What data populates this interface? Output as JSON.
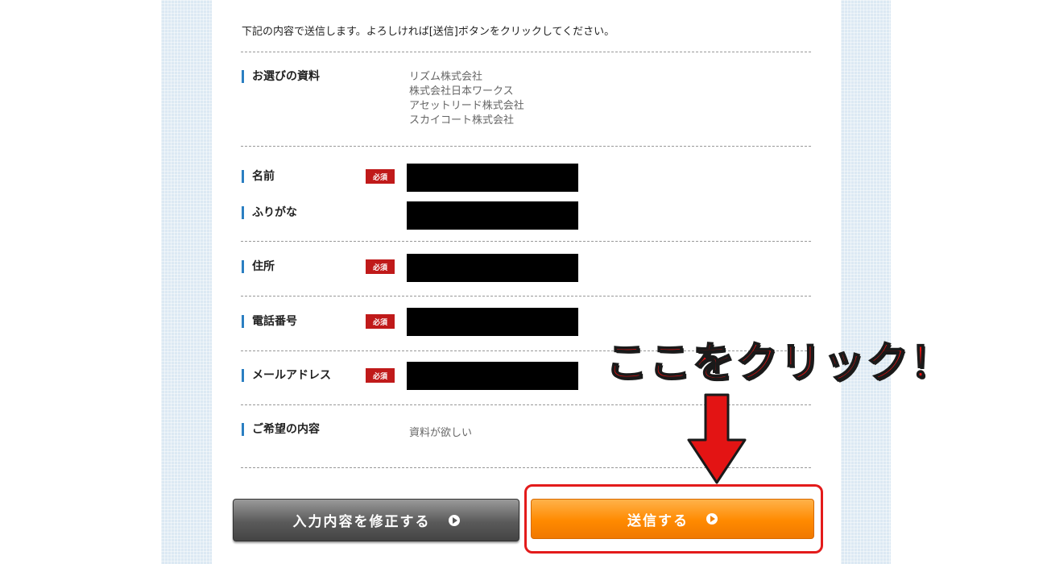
{
  "intro_text": "下記の内容で送信します。よろしければ[送信]ボタンをクリックしてください。",
  "required_label": "必須",
  "fields": {
    "documents": {
      "label": "お選びの資料",
      "values": [
        "リズム株式会社",
        "株式会社日本ワークス",
        "アセットリード株式会社",
        "スカイコート株式会社"
      ]
    },
    "name": {
      "label": "名前"
    },
    "furigana": {
      "label": "ふりがな"
    },
    "address": {
      "label": "住所"
    },
    "phone": {
      "label": "電話番号"
    },
    "email": {
      "label": "メールアドレス"
    },
    "request": {
      "label": "ご希望の内容",
      "value": "資料が欲しい"
    }
  },
  "buttons": {
    "back_label": "入力内容を修正する",
    "send_label": "送信する"
  },
  "annotation": {
    "callout_text": "ここをクリック！"
  },
  "colors": {
    "accent_blue": "#2b7fc2",
    "required_red": "#c01a1a",
    "send_orange": "#ff8a00",
    "annotation_red": "#ee1111"
  }
}
